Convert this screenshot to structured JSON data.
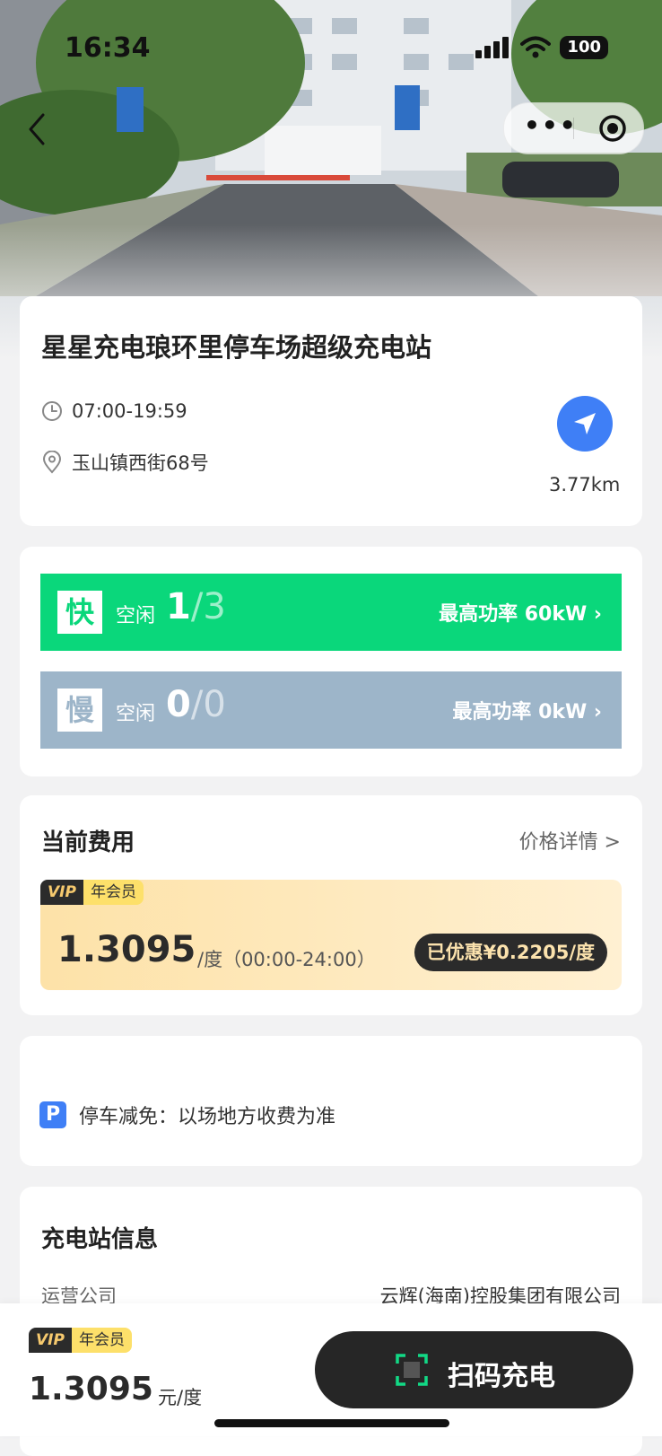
{
  "status_bar": {
    "time": "16:34",
    "battery": "100"
  },
  "station": {
    "name": "星星充电琅环里停车场超级充电站",
    "hours": "07:00-19:59",
    "address": "玉山镇西街68号",
    "distance": "3.77km"
  },
  "chargers": {
    "fast": {
      "tag": "快",
      "idle_label": "空闲",
      "available": "1",
      "total": "3",
      "power": "最高功率 60kW ›"
    },
    "slow": {
      "tag": "慢",
      "idle_label": "空闲",
      "available": "0",
      "total": "0",
      "power": "最高功率 0kW ›"
    }
  },
  "fee": {
    "title": "当前费用",
    "detail_link": "价格详情 >",
    "vip": "VIP",
    "member": "年会员",
    "price": "1.3095",
    "unit_time": "/度（00:00-24:00）",
    "discount": "已优惠¥0.2205/度"
  },
  "parking": {
    "badge": "P",
    "text": "停车减免：以场地方收费为准"
  },
  "station_info": {
    "title": "充电站信息",
    "operator_label": "运营公司",
    "operator_value": "云辉(海南)控股集团有限公司"
  },
  "footer": {
    "vip": "VIP",
    "member": "年会员",
    "price": "1.3095",
    "unit": "元/度",
    "scan_label": "扫码充电"
  },
  "colors": {
    "accent_blue": "#3f7ff6",
    "fast_green": "#0ad77b",
    "slow_gray": "#9db5c9",
    "dark": "#262626"
  }
}
